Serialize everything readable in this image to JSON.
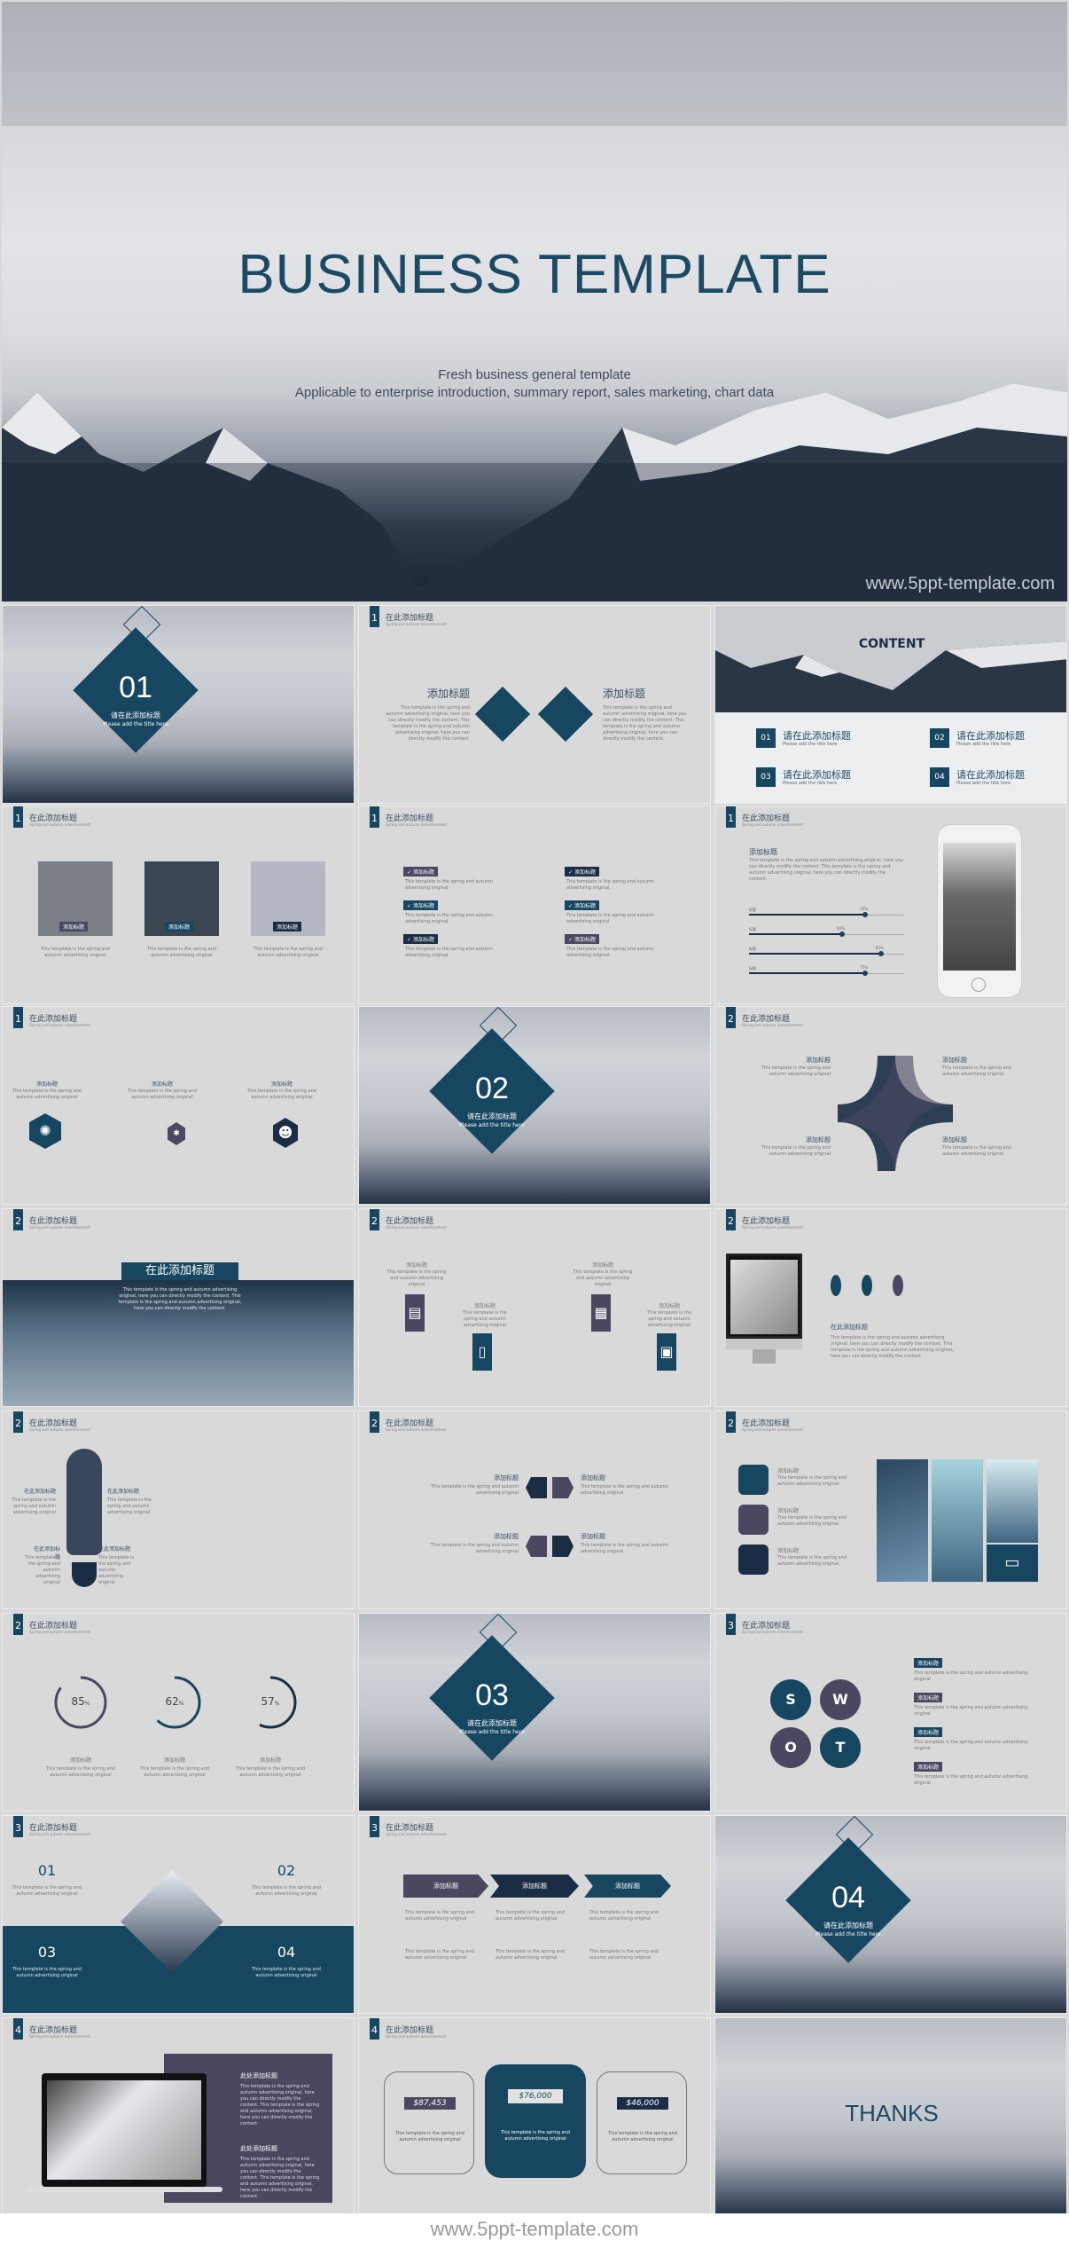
{
  "hero": {
    "title": "BUSINESS TEMPLATE",
    "subtitle_1": "Fresh business general template",
    "subtitle_2": "Applicable to enterprise introduction, summary report, sales marketing, chart data",
    "watermark": "www.5ppt-template.com"
  },
  "common": {
    "slide_title": "在此添加标题",
    "slide_subtitle": "Spring and autumn advertisement",
    "add_title": "添加标题",
    "add_title_here": "请在此添加标题",
    "please_add": "Please add the title here",
    "body_short": "This template is the spring and autumn advertising original",
    "body_long": "This template is the spring and autumn advertising original, here you can directly modify the content. This template is the spring and autumn advertising original, here you can directly modify the content."
  },
  "section_slides": [
    {
      "number": "01",
      "title": "请在此添加标题",
      "subtitle": "Please add the title here"
    },
    {
      "number": "02",
      "title": "请在此添加标题",
      "subtitle": "Please add the title here"
    },
    {
      "number": "03",
      "title": "请在此添加标题",
      "subtitle": "Please add the title here"
    },
    {
      "number": "04",
      "title": "请在此添加标题",
      "subtitle": "Please add the title here"
    }
  ],
  "content_slide": {
    "title": "CONTENT",
    "items": [
      {
        "num": "01",
        "title": "请在此添加标题",
        "sub": "Please add the title here"
      },
      {
        "num": "02",
        "title": "请在此添加标题",
        "sub": "Please add the title here"
      },
      {
        "num": "03",
        "title": "请在此添加标题",
        "sub": "Please add the title here"
      },
      {
        "num": "04",
        "title": "请在此添加标题",
        "sub": "Please add the title here"
      }
    ]
  },
  "section_numbers": [
    "1",
    "1",
    "1",
    "1",
    "1",
    "2",
    "2",
    "2",
    "2",
    "2",
    "2",
    "2",
    "2",
    "3",
    "3",
    "3",
    "4",
    "4"
  ],
  "progress_slide": {
    "heading": "添加标题",
    "bars": [
      {
        "label": "标题",
        "value": 75,
        "text": "75%"
      },
      {
        "label": "标题",
        "value": 60,
        "text": "60%"
      },
      {
        "label": "标题",
        "value": 85,
        "text": "85%"
      },
      {
        "label": "标题",
        "value": 75,
        "text": "75%"
      }
    ]
  },
  "rings_slide": {
    "rings": [
      {
        "value": 85,
        "text": "85",
        "unit": "%",
        "label": "添加标题"
      },
      {
        "value": 62,
        "text": "62",
        "unit": "%",
        "label": "添加标题"
      },
      {
        "value": 57,
        "text": "57",
        "unit": "%",
        "label": "添加标题"
      }
    ]
  },
  "swot_slide": {
    "letters": [
      "S",
      "W",
      "O",
      "T"
    ],
    "tags": [
      "添加标题",
      "添加标题",
      "添加标题",
      "添加标题"
    ]
  },
  "price_slide": {
    "cards": [
      {
        "price": "$87,453",
        "text": "This template is the spring and autumn advertising original"
      },
      {
        "price": "$76,000",
        "text": "This template is the spring and autumn advertising original"
      },
      {
        "price": "$46,000",
        "text": "This template is the spring and autumn advertising original"
      }
    ]
  },
  "laptop_slide": {
    "heading": "此处添加标题"
  },
  "banner_slide": {
    "heading": "在此添加标题"
  },
  "imac_slide": {
    "heading": "在此添加标题"
  },
  "team_slide": {
    "nums": [
      "01",
      "02",
      "03",
      "04"
    ]
  },
  "thanks": {
    "title": "THANKS"
  },
  "footer": {
    "text": "www.5ppt-template.com"
  },
  "colors": {
    "navy": "#174760",
    "purple": "#4a4760",
    "dark": "#1b2d45",
    "bg": "#d9d9d9"
  }
}
